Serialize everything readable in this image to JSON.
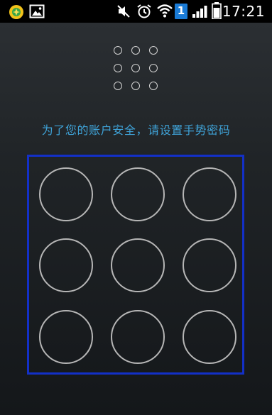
{
  "status_bar": {
    "time": "17:21",
    "sim_badge": "1",
    "icons": [
      "app-notification-icon",
      "image-notification-icon",
      "mute-icon",
      "alarm-icon",
      "wifi-icon",
      "sim-slot-icon",
      "signal-icon",
      "battery-icon"
    ]
  },
  "lock_screen": {
    "prompt": "为了您的账户安全，请设置手势密码",
    "preview_dots": 9,
    "pattern_nodes": 9
  },
  "colors": {
    "prompt_text": "#3fa3d8",
    "frame_border": "#1330c8",
    "circle_stroke": "#b6b6b6"
  }
}
